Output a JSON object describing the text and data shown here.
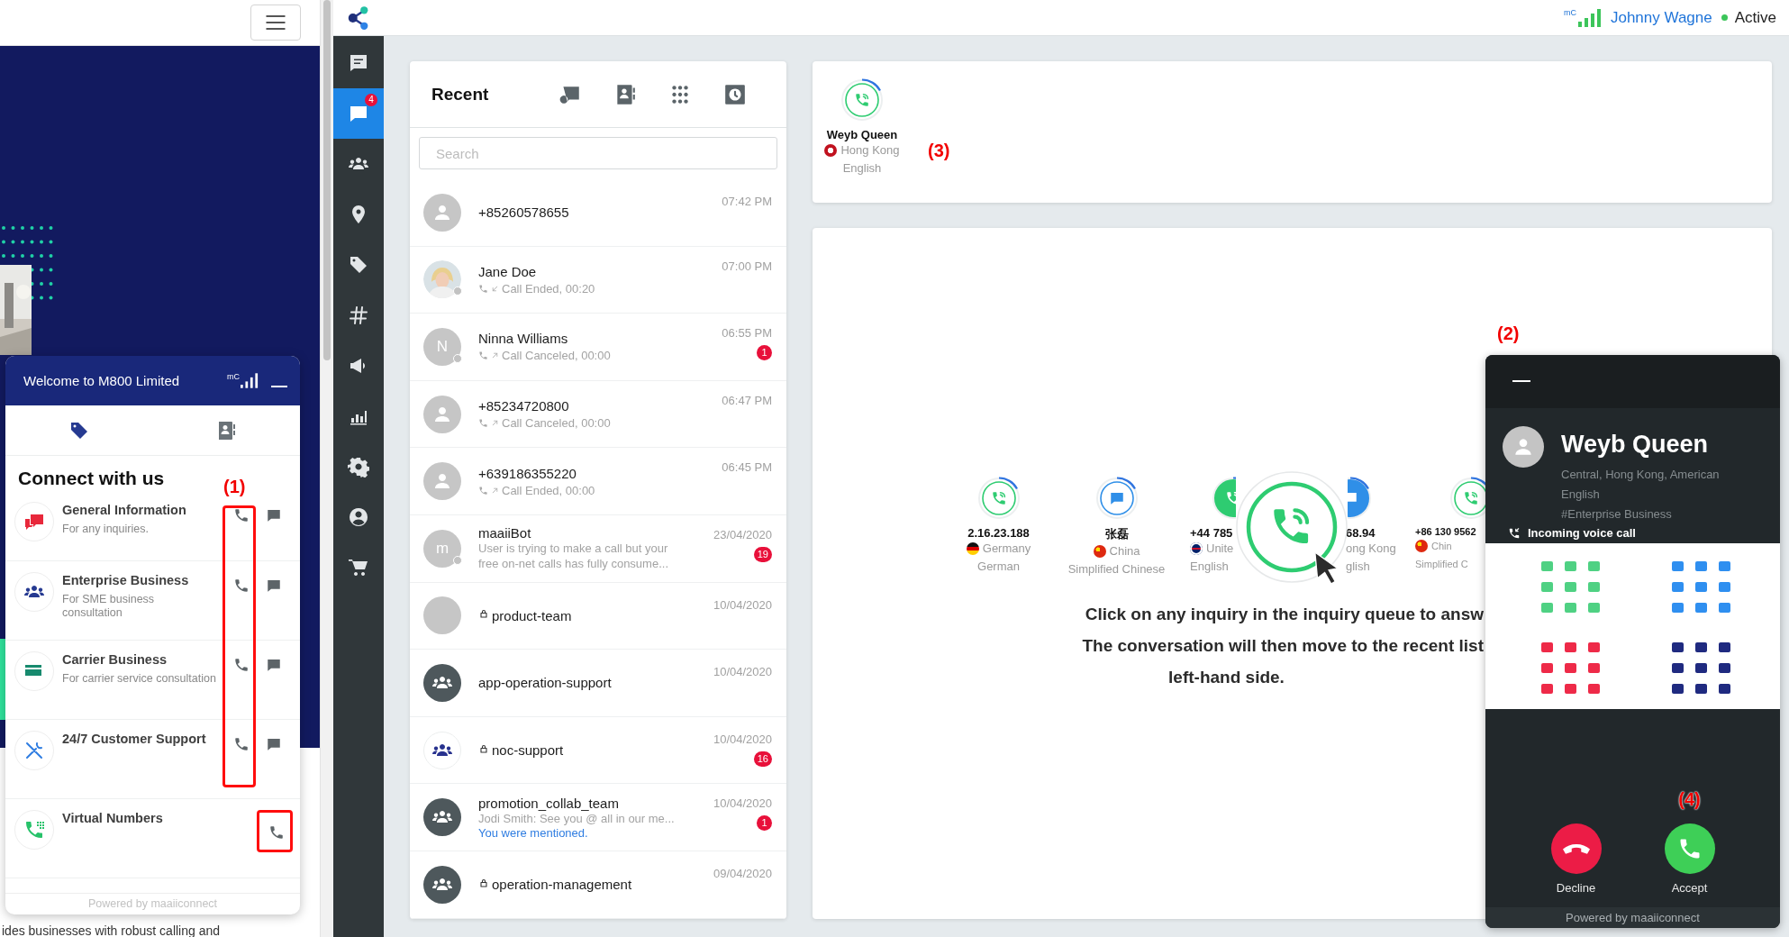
{
  "background_page": {
    "footer_text": "ides businesses with robust calling and"
  },
  "widget": {
    "title": "Welcome to M800 Limited",
    "signal_label": "mC",
    "annotation": "(1)",
    "tabs": [
      {
        "selected": true
      },
      {
        "selected": false
      }
    ],
    "heading": "Connect with us",
    "items": [
      {
        "title": "General Information",
        "subtitle": "For any inquiries.",
        "chat": true
      },
      {
        "title": "Enterprise Business",
        "subtitle": "For SME business consultation",
        "chat": true
      },
      {
        "title": "Carrier Business",
        "subtitle": "For carrier service consultation",
        "chat": true
      },
      {
        "title": "24/7 Customer Support",
        "chat": true
      },
      {
        "title": "Virtual Numbers",
        "chat": false
      }
    ],
    "footer": "Powered by maaiiconnect"
  },
  "topbar": {
    "signal_label": "mC",
    "user": "Johnny Wagne",
    "status": "Active"
  },
  "sidebar": {
    "items": [
      {
        "selected": false
      },
      {
        "selected": true,
        "badge": "4"
      },
      {
        "selected": false
      },
      {
        "selected": false
      },
      {
        "selected": false
      },
      {
        "selected": false
      },
      {
        "selected": false
      },
      {
        "selected": false
      },
      {
        "selected": false
      },
      {
        "selected": false
      },
      {
        "selected": false
      }
    ]
  },
  "recent": {
    "title": "Recent",
    "search": {
      "placeholder": "Search"
    },
    "rows": [
      {
        "name": "+85260578655",
        "time": "07:42 PM",
        "kind": "person",
        "presence": false,
        "locked": false
      },
      {
        "name": "Jane Doe",
        "time": "07:00 PM",
        "presence": true,
        "locked": false,
        "detail": "Call Ended, 00:20",
        "incoming": true
      },
      {
        "name": "Ninna Williams",
        "time": "06:55 PM",
        "kind": "letter",
        "initial": "N",
        "presence": true,
        "locked": false,
        "detail": "Call Canceled, 00:00",
        "incoming": false,
        "badge": "1"
      },
      {
        "name": "+85234720800",
        "time": "06:47 PM",
        "kind": "person",
        "presence": false,
        "locked": false,
        "detail": "Call Canceled, 00:00",
        "incoming": false
      },
      {
        "name": "+639186355220",
        "time": "06:45 PM",
        "kind": "person",
        "presence": false,
        "locked": false,
        "detail": "Call Ended, 00:00",
        "incoming": false
      },
      {
        "name": "maaiiBot",
        "time": "23/04/2020",
        "kind": "letter",
        "initial": "m",
        "presence": true,
        "locked": false,
        "preview_lines": [
          "User is trying to make a call but your",
          "free on-net calls has fully consume..."
        ],
        "badge": "19"
      },
      {
        "name": "product-team",
        "time": "10/04/2020",
        "kind": "blank",
        "presence": false,
        "locked": true
      },
      {
        "name": "app-operation-support",
        "time": "10/04/2020",
        "kind": "group",
        "presence": false,
        "locked": false
      },
      {
        "name": "noc-support",
        "time": "10/04/2020",
        "kind": "team",
        "presence": false,
        "locked": true,
        "badge": "16"
      },
      {
        "name": "promotion_collab_team",
        "time": "10/04/2020",
        "kind": "group",
        "presence": false,
        "locked": false,
        "preview_lines": [
          "Jodi Smith: See you @ all in our me..."
        ],
        "mention": "You were mentioned.",
        "badge": "1"
      },
      {
        "name": "operation-management",
        "time": "09/04/2020",
        "kind": "group",
        "presence": false,
        "locked": true
      }
    ]
  },
  "incoming": {
    "annotation": "(3)",
    "items": [
      {
        "name": "Weyb Queen",
        "country": "Hong Kong",
        "language": "English",
        "kind": "voice"
      }
    ]
  },
  "queue": {
    "items": [
      {
        "name": "2.16.23.188",
        "country": "Germany",
        "language": "German",
        "kind": "voice"
      },
      {
        "name": "张磊",
        "country": "China",
        "language": "Simplified Chinese",
        "kind": "chat"
      },
      {
        "name": "+44 785",
        "country": "Unite",
        "language": "English",
        "kind": "voice"
      },
      {
        "name": "68.94",
        "country": "ong Kong",
        "language": "glish",
        "kind": "chat"
      },
      {
        "name": "+86 130 9562",
        "country": "Chin",
        "language": "Simplified C",
        "kind": "voice"
      }
    ],
    "message_lines": [
      "Click on any inquiry in the inquiry queue to answ",
      "The conversation will then move to the recent list",
      "left-hand side."
    ]
  },
  "call_popup": {
    "annotation": "(2)",
    "name": "Weyb Queen",
    "details": [
      "Central, Hong Kong, American English",
      "#Enterprise Business"
    ],
    "call_label": "Incoming voice call",
    "decline": "Decline",
    "accept": "Accept",
    "accept_annotation": "(4)",
    "footer": "Powered by maaiiconnect"
  }
}
